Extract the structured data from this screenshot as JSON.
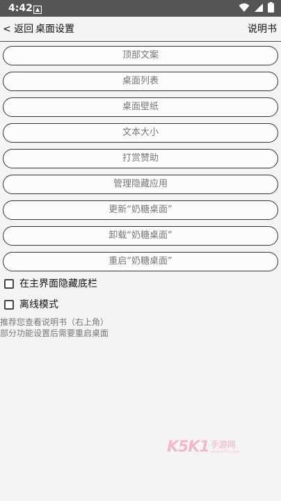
{
  "status_bar": {
    "time": "4:42"
  },
  "app_bar": {
    "back_label": "< 返回",
    "title": "桌面设置",
    "manual_label": "说明书"
  },
  "menu": {
    "items": [
      "顶部文案",
      "桌面列表",
      "桌面壁纸",
      "文本大小",
      "打赏赞助",
      "管理隐藏应用",
      "更新“奶糖桌面”",
      "卸载“奶糖桌面”",
      "重启“奶糖桌面”"
    ]
  },
  "options": {
    "hide_bottom_bar_label": "在主界面隐藏底栏",
    "hide_bottom_bar_checked": false,
    "offline_mode_label": "离线模式",
    "offline_mode_checked": false
  },
  "notes": {
    "line1": "推荐您查看说明书（右上角）",
    "line2": "部分功能设置后需要重启桌面"
  },
  "watermark": {
    "logo": "K5K1",
    "main": "手游网",
    "sub": "www.k51.com"
  },
  "colors": {
    "status_bar": "#555555",
    "background": "#f4f4f4",
    "button_border": "#333333",
    "button_text": "#777777",
    "watermark": "#ef8aa5"
  }
}
